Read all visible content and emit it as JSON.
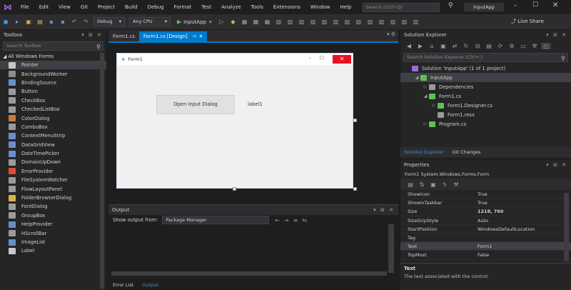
{
  "menubar": {
    "items": [
      "File",
      "Edit",
      "View",
      "Git",
      "Project",
      "Build",
      "Debug",
      "Format",
      "Test",
      "Analyze",
      "Tools",
      "Extensions",
      "Window",
      "Help"
    ],
    "search_placeholder": "Search (Ctrl+Q)",
    "app_title": "InputApp"
  },
  "toolbar": {
    "config": "Debug",
    "platform": "Any CPU",
    "run_label": "InputApp",
    "live_share": "Live Share"
  },
  "toolbox": {
    "title": "Toolbox",
    "search_placeholder": "Search Toolbox",
    "section": "All Windows Forms",
    "items": [
      {
        "label": "Pointer",
        "color": "#c8c8c8"
      },
      {
        "label": "BackgroundWorker",
        "color": "#8c8c8c"
      },
      {
        "label": "BindingSource",
        "color": "#6a8fc8"
      },
      {
        "label": "Button",
        "color": "#9a9a9a"
      },
      {
        "label": "CheckBox",
        "color": "#9a9a9a"
      },
      {
        "label": "CheckedListBox",
        "color": "#9a9a9a"
      },
      {
        "label": "ColorDialog",
        "color": "#c87a3a"
      },
      {
        "label": "ComboBox",
        "color": "#9a9a9a"
      },
      {
        "label": "ContextMenuStrip",
        "color": "#6a8fc8"
      },
      {
        "label": "DataGridView",
        "color": "#6a8fc8"
      },
      {
        "label": "DateTimePicker",
        "color": "#6a8fc8"
      },
      {
        "label": "DomainUpDown",
        "color": "#9a9a9a"
      },
      {
        "label": "ErrorProvider",
        "color": "#e04a3a"
      },
      {
        "label": "FileSystemWatcher",
        "color": "#9a9a9a"
      },
      {
        "label": "FlowLayoutPanel",
        "color": "#9a9a9a"
      },
      {
        "label": "FolderBrowserDialog",
        "color": "#d8b24a"
      },
      {
        "label": "FontDialog",
        "color": "#9a9a9a"
      },
      {
        "label": "GroupBox",
        "color": "#9a9a9a"
      },
      {
        "label": "HelpProvider",
        "color": "#6a8fc8"
      },
      {
        "label": "HScrollBar",
        "color": "#9a9a9a"
      },
      {
        "label": "ImageList",
        "color": "#6a8fc8"
      },
      {
        "label": "Label",
        "color": "#c8c8c8"
      }
    ]
  },
  "doc_tabs": [
    {
      "label": "Form1.cs",
      "active": false
    },
    {
      "label": "Form1.cs [Design]",
      "active": true
    }
  ],
  "form": {
    "title": "Form1",
    "button_text": "Open Input Dialog",
    "label_text": "label1"
  },
  "output": {
    "title": "Output",
    "show_from_label": "Show output from:",
    "source": "Package Manager",
    "tabs": [
      {
        "label": "Error List",
        "active": false
      },
      {
        "label": "Output",
        "active": true
      }
    ]
  },
  "solution_explorer": {
    "title": "Solution Explorer",
    "search_placeholder": "Search Solution Explorer (Ctrl+;)",
    "tree": [
      {
        "label": "Solution 'InputApp' (1 of 1 project)",
        "indent": 0,
        "color": "#9b6cd6",
        "arrow": "",
        "selected": false
      },
      {
        "label": "InputApp",
        "indent": 1,
        "color": "#5fbf55",
        "arrow": "◢",
        "selected": true
      },
      {
        "label": "Dependencies",
        "indent": 2,
        "color": "#9a9a9a",
        "arrow": "▷",
        "selected": false
      },
      {
        "label": "Form1.cs",
        "indent": 2,
        "color": "#5fbf55",
        "arrow": "◢",
        "selected": false
      },
      {
        "label": "Form1.Designer.cs",
        "indent": 3,
        "color": "#5fbf55",
        "arrow": "▷",
        "selected": false
      },
      {
        "label": "Form1.resx",
        "indent": 3,
        "color": "#9a9a9a",
        "arrow": "",
        "selected": false
      },
      {
        "label": "Program.cs",
        "indent": 2,
        "color": "#5fbf55",
        "arrow": "▷",
        "selected": false
      }
    ],
    "tabs": [
      {
        "label": "Solution Explorer",
        "active": true
      },
      {
        "label": "Git Changes",
        "active": false
      }
    ]
  },
  "properties": {
    "title": "Properties",
    "object": "Form1  System.Windows.Forms.Form",
    "rows": [
      {
        "name": "ShowIcon",
        "value": "True",
        "bold": false
      },
      {
        "name": "ShowInTaskbar",
        "value": "True",
        "bold": false
      },
      {
        "name": "Size",
        "value": "1218, 760",
        "bold": true
      },
      {
        "name": "SizeGripStyle",
        "value": "Auto",
        "bold": false
      },
      {
        "name": "StartPosition",
        "value": "WindowsDefaultLocation",
        "bold": false
      },
      {
        "name": "Tag",
        "value": "",
        "bold": false
      },
      {
        "name": "Text",
        "value": "Form1",
        "bold": false
      },
      {
        "name": "TopMost",
        "value": "False",
        "bold": false
      }
    ],
    "desc_title": "Text",
    "desc_text": "The text associated with the control."
  }
}
